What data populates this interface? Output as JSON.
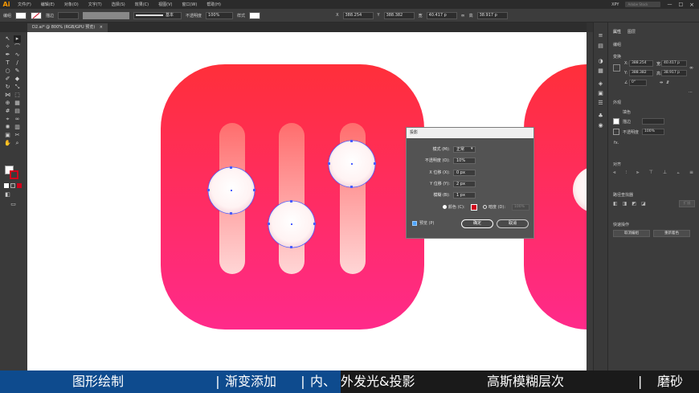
{
  "app": {
    "logo": "Ai"
  },
  "menu": [
    "文件(F)",
    "编辑(E)",
    "对象(O)",
    "文字(T)",
    "选择(S)",
    "效果(C)",
    "视图(V)",
    "窗口(W)",
    "帮助(H)"
  ],
  "menu_right": {
    "workspace": "XPY",
    "search_placeholder": "Adobe Stock"
  },
  "control_bar": {
    "label_no_selection": "编组",
    "stroke_label": "描边",
    "stroke_style": "基本",
    "opacity_label": "不透明度",
    "opacity_value": "100%",
    "style_label": "样式",
    "x_label": "X",
    "x_value": "388.254",
    "y_label": "Y",
    "y_value": "388.382",
    "w_label": "宽",
    "w_value": "40.417 p",
    "h_label": "高",
    "h_value": "38.917 p"
  },
  "doc_tab": {
    "title": "D2.ai* @ 800% (RGB/GPU 预览)",
    "close": "×"
  },
  "dialog": {
    "title": "投影",
    "mode_label": "模式 (M):",
    "mode_value": "正常",
    "opacity_label": "不透明度 (O):",
    "opacity_value": "10%",
    "xoffset_label": "X 位移 (X):",
    "xoffset_value": "0 px",
    "yoffset_label": "Y 位移 (Y):",
    "yoffset_value": "2 px",
    "blur_label": "模糊 (B):",
    "blur_value": "1 px",
    "color_label": "颜色 (C):",
    "darkness_label": "暗度 (D):",
    "darkness_value": "100%",
    "preview_label": "预览 (P)",
    "ok_label": "确定",
    "cancel_label": "取消",
    "shadow_color": "#d0021b"
  },
  "panel": {
    "tab_properties": "属性",
    "tab_layers": "图层",
    "section_group": "编组",
    "section_transform": "变换",
    "x_label": "X:",
    "x_value": "388.254",
    "y_label": "Y:",
    "y_value": "388.382",
    "w_label": "宽:",
    "w_value": "40.417 p",
    "h_label": "高:",
    "h_value": "38.917 p",
    "rotate_value": "0°",
    "section_appearance": "外观",
    "fill_label": "填色",
    "stroke_label": "描边",
    "opacity_label": "不透明度",
    "opacity_value": "100%",
    "fx_label": "fx.",
    "section_align": "对齐",
    "section_pathfinder": "路径查找器",
    "expand_label": "扩展",
    "section_quick": "快速操作",
    "ungroup_label": "取消编组",
    "recolor_label": "重新着色"
  },
  "caption": {
    "seg1": "图形绘制",
    "sep1": "|",
    "seg2": "渐变添加",
    "sep2": "|",
    "seg3": "内、",
    "seg4": "外发光&投影",
    "sep3": "|",
    "seg5": "高斯模糊层次",
    "sep4": "|",
    "seg6": "磨砂"
  },
  "colors": {
    "icon_gradient_top": "#ff2f3a",
    "icon_gradient_bottom": "#ff2a8a",
    "anchor_blue": "#4a5cff",
    "caption_blue": "#0e4b8e",
    "accent_orange": "#ff9a00"
  }
}
